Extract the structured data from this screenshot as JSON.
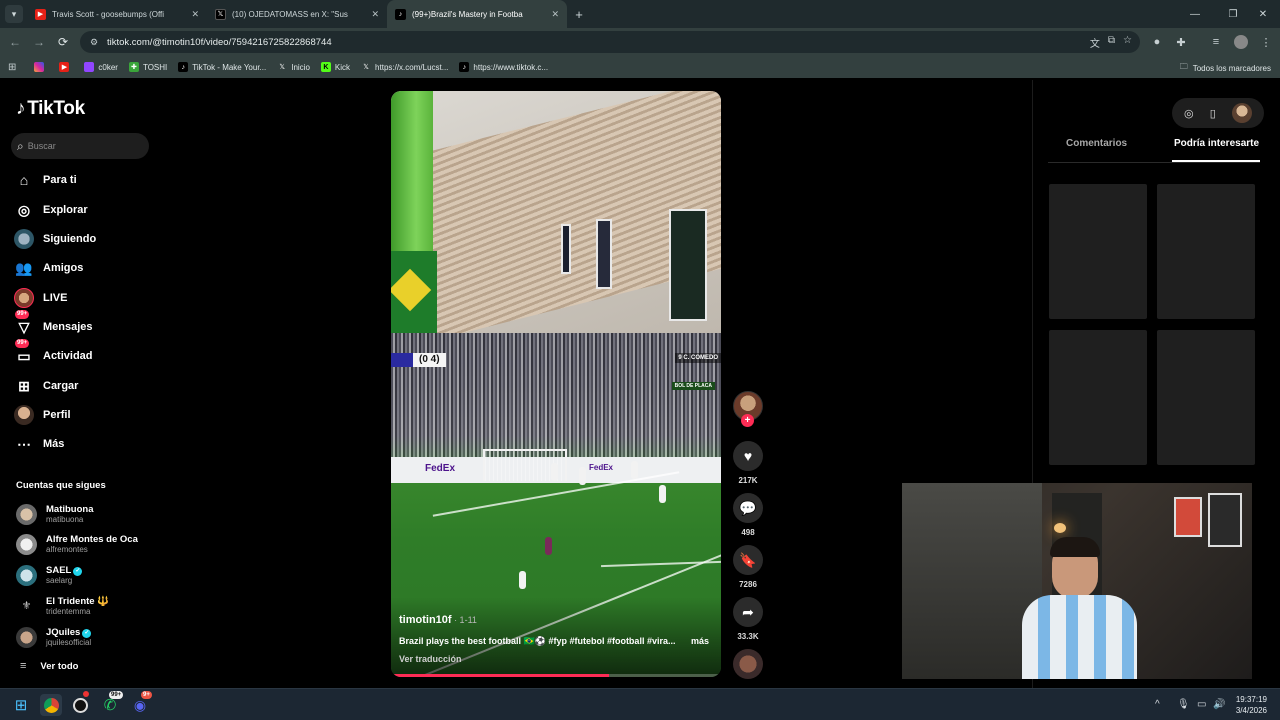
{
  "browser": {
    "tabs": [
      {
        "title": "Travis Scott - goosebumps (Offi",
        "favicon": "youtube-icon",
        "active": false
      },
      {
        "title": "(10) OJEDATOMASS en X: \"Sus",
        "favicon": "x-icon",
        "active": false
      },
      {
        "title": "(99+)Brazil's Mastery in Footba",
        "favicon": "tiktok-icon",
        "active": true
      }
    ],
    "new_tab": "+",
    "url": "tiktok.com/@timotin10f/video/7594216725822868744",
    "bookmarks": [
      {
        "label": "",
        "icon": "instagram-icon"
      },
      {
        "label": "",
        "icon": "youtube-icon"
      },
      {
        "label": "c0ker",
        "icon": "twitch-icon"
      },
      {
        "label": "TOSHI",
        "icon": "toshi-icon"
      },
      {
        "label": "TikTok - Make Your...",
        "icon": "tiktok-icon"
      },
      {
        "label": "Inicio",
        "icon": "x-icon"
      },
      {
        "label": "Kick",
        "icon": "kick-icon"
      },
      {
        "label": "https://x.com/Lucst...",
        "icon": "x-icon"
      },
      {
        "label": "https://www.tiktok.c...",
        "icon": "tiktok-icon"
      }
    ],
    "all_bookmarks": "Todos los marcadores"
  },
  "tiktok": {
    "logo": "TikTok",
    "search_placeholder": "Buscar",
    "nav": [
      {
        "label": "Para ti",
        "icon": "home-icon"
      },
      {
        "label": "Explorar",
        "icon": "compass-icon"
      },
      {
        "label": "Siguiendo",
        "icon": "following-avatar-icon"
      },
      {
        "label": "Amigos",
        "icon": "friends-icon"
      },
      {
        "label": "LIVE",
        "icon": "live-avatar-icon"
      },
      {
        "label": "Mensajes",
        "icon": "messages-icon",
        "badge": "99+"
      },
      {
        "label": "Actividad",
        "icon": "activity-icon",
        "badge": "99+"
      },
      {
        "label": "Cargar",
        "icon": "upload-icon"
      },
      {
        "label": "Perfil",
        "icon": "profile-avatar-icon"
      },
      {
        "label": "Más",
        "icon": "more-icon"
      }
    ],
    "following_header": "Cuentas que sigues",
    "following": [
      {
        "name": "Matibuona",
        "handle": "matibuona",
        "verified": false,
        "suffix": ""
      },
      {
        "name": "Alfre Montes de Oca",
        "handle": "alfremontes",
        "verified": false,
        "suffix": ""
      },
      {
        "name": "SAEL",
        "handle": "saelarg",
        "verified": true,
        "suffix": ""
      },
      {
        "name": "El Tridente",
        "handle": "tridentemma",
        "verified": false,
        "suffix": "🔱"
      },
      {
        "name": "JQuiles",
        "handle": "jquilesofficial",
        "verified": true,
        "suffix": ""
      }
    ],
    "see_all": "Ver todo",
    "video": {
      "author": "timotin10f",
      "date": " · 1-11",
      "description": "Brazil plays the best football 🇧🇷⚽ #fyp #futebol #football #vira...",
      "more": "más",
      "translate": "Ver traducción",
      "scoreboard": "(0  4)",
      "hud_right": "9  C. COMEDO",
      "hud_right2": "BOL DE PLACA",
      "ad_text": "FedEx",
      "progress": 0.66
    },
    "actions": {
      "likes": "217K",
      "comments": "498",
      "saves": "7286",
      "shares": "33.3K"
    },
    "right_panel": {
      "tab_comments": "Comentarios",
      "tab_interest": "Podría interesarte"
    }
  },
  "taskbar": {
    "whatsapp_badge": "99+",
    "discord_badge": "9+",
    "time": "19:37:19",
    "date": "3/4/2026"
  }
}
